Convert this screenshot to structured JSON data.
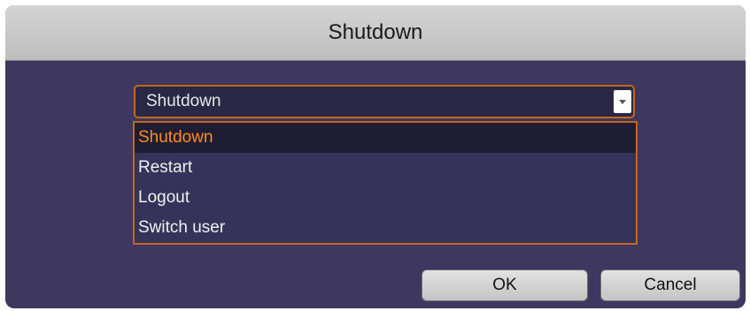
{
  "dialog": {
    "title": "Shutdown",
    "select": {
      "value": "Shutdown",
      "options": [
        "Shutdown",
        "Restart",
        "Logout",
        "Switch user"
      ],
      "highlighted_index": 0
    },
    "buttons": {
      "ok": "OK",
      "cancel": "Cancel"
    }
  },
  "colors": {
    "background": "#3e3760",
    "accent": "#c06a1a",
    "selected_text": "#ff8c1a",
    "titlebar": "#c9c9c9"
  },
  "icons": {
    "dropdown_arrow": "chevron-down-icon"
  }
}
